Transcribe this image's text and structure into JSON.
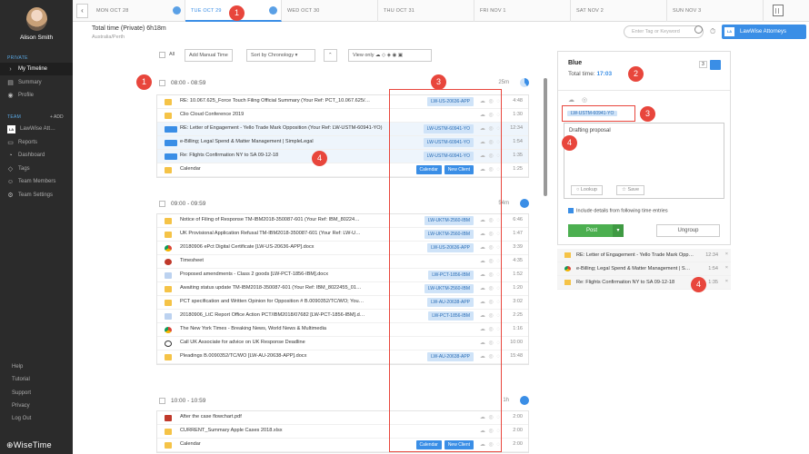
{
  "sidebar": {
    "user_name": "Alison Smith",
    "private_label": "PRIVATE",
    "private_items": [
      {
        "label": "My Timeline",
        "icon": "chevron-right-icon"
      },
      {
        "label": "Summary",
        "icon": "summary-icon"
      },
      {
        "label": "Profile",
        "icon": "profile-icon"
      }
    ],
    "team_label": "TEAM",
    "add_label": "+ ADD",
    "team_items": [
      {
        "label": "LawWise Att…",
        "icon": "team-logo"
      },
      {
        "label": "Reports",
        "icon": "reports-icon"
      },
      {
        "label": "Dashboard",
        "icon": "dashboard-icon"
      },
      {
        "label": "Tags",
        "icon": "tag-icon"
      },
      {
        "label": "Team Members",
        "icon": "team-members-icon"
      },
      {
        "label": "Team Settings",
        "icon": "settings-icon"
      }
    ],
    "footer_items": [
      "Help",
      "Tutorial",
      "Support",
      "Privacy",
      "Log Out"
    ],
    "brand": "⊕WiseTime"
  },
  "datebar": {
    "dates": [
      "MON OCT 28",
      "TUE OCT 29",
      "WED OCT 30",
      "THU OCT 31",
      "FRI NOV 1",
      "SAT NOV 2",
      "SUN NOV 3"
    ],
    "active_index": 1
  },
  "header": {
    "total": "Total time (Private) 6h18m",
    "timezone": "Australia/Perth",
    "search_placeholder": "Enter Tag or Keyword",
    "org_button": "LawWise Attorneys",
    "org_logo": "LA"
  },
  "toolbar": {
    "all": "All",
    "add_manual": "Add Manual Time",
    "sort": "Sort by Chronology",
    "sort_chevron": "▾",
    "up": "⌃",
    "view_only": "View only"
  },
  "groups": [
    {
      "time": "08:00 - 08:59",
      "duration": "25m",
      "rows": [
        {
          "icon": "folder",
          "text": "RE: 10.067.625_Force Touch Filing Official Summary (Your Ref: PCT_10.067.625/…",
          "tags": [
            "LW-US-20636-APP"
          ],
          "dur": "4:48"
        },
        {
          "icon": "folder",
          "text": "Clio Cloud Conference 2019",
          "tags": [],
          "dur": "1:30"
        },
        {
          "icon": "grp",
          "text": "RE: Letter of Engagement - Yello Trade Mark Opposition (Your Ref: LW-USTM-60941-YO)",
          "tags": [
            "LW-USTM-60941-YO"
          ],
          "dur": "12:34",
          "sel": true
        },
        {
          "icon": "grp",
          "text": "e-Billing; Legal Spend & Matter Management | SimpleLegal",
          "tags": [
            "LW-USTM-60941-YO"
          ],
          "dur": "1:54",
          "sel": true
        },
        {
          "icon": "grp",
          "text": "Re: Flights Confirmation NY to SA 09-12-18",
          "tags": [
            "LW-USTM-60941-YO"
          ],
          "dur": "1:35",
          "sel": true
        },
        {
          "icon": "folder",
          "text": "Calendar",
          "tags": [
            "Calendar",
            "New Client"
          ],
          "dur": "1:25",
          "tagdark": true
        }
      ]
    },
    {
      "time": "09:00 - 09:59",
      "duration": "54m",
      "rows": [
        {
          "icon": "folder",
          "text": "Notice of Filing of Response TM-IBM2018-350087-601 (Your Ref: IBM_80224…",
          "tags": [
            "LW-UKTM-2560-IBM"
          ],
          "dur": "6:46"
        },
        {
          "icon": "folder",
          "text": "UK Provisional Application Refusal TM-IBM2018-350087-601 (Your Ref: LW-U…",
          "tags": [
            "LW-UKTM-2560-IBM"
          ],
          "dur": "1:47"
        },
        {
          "icon": "web",
          "text": "20180906 ePct Digital Certificate [LW-US-20636-APP].docx",
          "tags": [
            "LW-US-20636-APP"
          ],
          "dur": "3:39"
        },
        {
          "icon": "ti",
          "text": "Timesheet",
          "tags": [],
          "dur": "4:35"
        },
        {
          "icon": "doc",
          "text": "Proposed amendments - Class 2 goods [LW-PCT-1856-IBM].docx",
          "tags": [
            "LW-PCT-1856-IBM"
          ],
          "dur": "1:52"
        },
        {
          "icon": "folder",
          "text": "Awaiting status update TM-IBM2018-350087-601 (Your Ref: IBM_8022455_01…",
          "tags": [
            "LW-UKTM-2560-IBM"
          ],
          "dur": "1:20"
        },
        {
          "icon": "folder",
          "text": "PCT specification and Written Opinion for Opposition # B.0090352/TC/WO; You…",
          "tags": [
            "LW-AU-20638-APP"
          ],
          "dur": "3:02"
        },
        {
          "icon": "doc",
          "text": "20180906_LtC Report Office Action PCT/IBM2018/07682 [LW-PCT-1856-IBM].d…",
          "tags": [
            "LW-PCT-1856-IBM"
          ],
          "dur": "2:25"
        },
        {
          "icon": "web",
          "text": "The New York Times - Breaking News, World News & Multimedia",
          "tags": [],
          "dur": "1:16"
        },
        {
          "icon": "ph",
          "text": "Call UK Associate for advice on UK Response Deadline",
          "tags": [],
          "dur": "10:00"
        },
        {
          "icon": "folder",
          "text": "Pleadings B.0090352/TC/WO [LW-AU-20638-APP].docx",
          "tags": [
            "LW-AU-20638-APP"
          ],
          "dur": "15:48"
        }
      ]
    },
    {
      "time": "10:00 - 10:59",
      "duration": "1h",
      "rows": [
        {
          "icon": "pdf",
          "text": "After the case flowchart.pdf",
          "tags": [],
          "dur": "2:00"
        },
        {
          "icon": "xls",
          "text": "CURRENT_Summary Apple Cases 2018.xlsx",
          "tags": [],
          "dur": "2:00"
        },
        {
          "icon": "folder",
          "text": "Calendar",
          "tags": [
            "Calendar",
            "New Client"
          ],
          "dur": "2:00",
          "tagdark": true
        }
      ]
    }
  ],
  "panel": {
    "title": "Blue",
    "total_label": "Total time: ",
    "total_value": "17:03",
    "count": "3",
    "tag": "LW-USTM-60941-YO",
    "text": "Drafting proposal",
    "lookup": "Lookup",
    "save": "Save",
    "include": "Include details from following time entries",
    "post": "Post",
    "ungroup": "Ungroup",
    "entries": [
      {
        "icon": "folder",
        "text": "RE: Letter of Engagement - Yello Trade Mark Opposition (You…",
        "dur": "12:34"
      },
      {
        "icon": "web",
        "text": "e-Billing; Legal Spend & Matter Management | S…",
        "dur": "1:54"
      },
      {
        "icon": "folder",
        "text": "Re: Flights Confirmation NY to SA 09-12-18",
        "dur": "1:35"
      }
    ]
  },
  "callouts": [
    "1",
    "1",
    "2",
    "3",
    "3",
    "4",
    "4",
    "4"
  ]
}
